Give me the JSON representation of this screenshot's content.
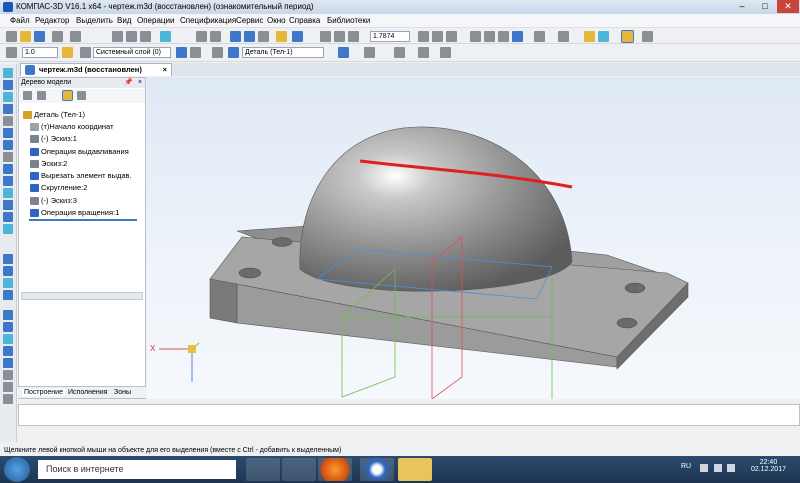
{
  "titlebar": {
    "title": "КОМПАС-3D V16.1 x64 - чертеж.m3d (восстановлен) (ознакомительный период)",
    "min": "–",
    "max": "□",
    "close": "✕"
  },
  "menu": [
    "Файл",
    "Редактор",
    "Выделить",
    "Вид",
    "Операции",
    "Спецификация",
    "Сервис",
    "Окно",
    "Справка",
    "Библиотеки"
  ],
  "toolbar2": {
    "zoom": "1.7874"
  },
  "toolbar3": {
    "step": "1.0",
    "layer": "Системный слой (0)",
    "detail": "Деталь (Тел-1)"
  },
  "doc_tab": {
    "label": "чертеж.m3d (восстановлен)",
    "close": "×"
  },
  "tree": {
    "header": "Дерево модели",
    "pin": "📌",
    "close": "×",
    "items": [
      "Деталь (Тел-1)",
      "(т)Начало координат",
      "(-) Эскиз:1",
      "Операция выдавливания",
      "Эскиз:2",
      "Вырезать элемент выдав.",
      "Скругление:2",
      "(-) Эскиз:3",
      "Операция вращения:1"
    ],
    "tabs": [
      "Построение",
      "Исполнения",
      "Зоны"
    ]
  },
  "hint": "Щелкните левой кнопкой мыши на объекте для его выделения (вместе с Ctrl - добавить к выделенным)",
  "taskbar": {
    "search_placeholder": "Поиск в интернете",
    "lang": "RU",
    "time": "22:40",
    "date": "02.12.2017"
  },
  "axes": {
    "x": "X"
  },
  "colors": {
    "accent": "#1a56b8",
    "edge_highlight": "#e02020",
    "sketch_plane": "#4a90e0"
  }
}
